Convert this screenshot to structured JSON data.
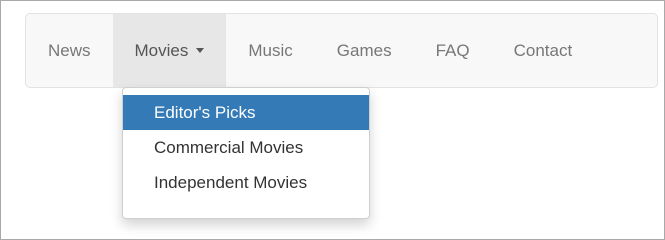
{
  "navbar": {
    "items": [
      {
        "label": "News"
      },
      {
        "label": "Movies"
      },
      {
        "label": "Music"
      },
      {
        "label": "Games"
      },
      {
        "label": "FAQ"
      },
      {
        "label": "Contact"
      }
    ],
    "active_index": 1
  },
  "dropdown": {
    "items": [
      {
        "label": "Editor's Picks",
        "highlighted": true
      },
      {
        "label": "Commercial Movies"
      },
      {
        "label": "Independent Movies"
      }
    ]
  },
  "colors": {
    "highlight": "#337ab7",
    "navbar_bg": "#f8f8f8",
    "active_bg": "#e7e7e7",
    "nav_text": "#777777"
  }
}
